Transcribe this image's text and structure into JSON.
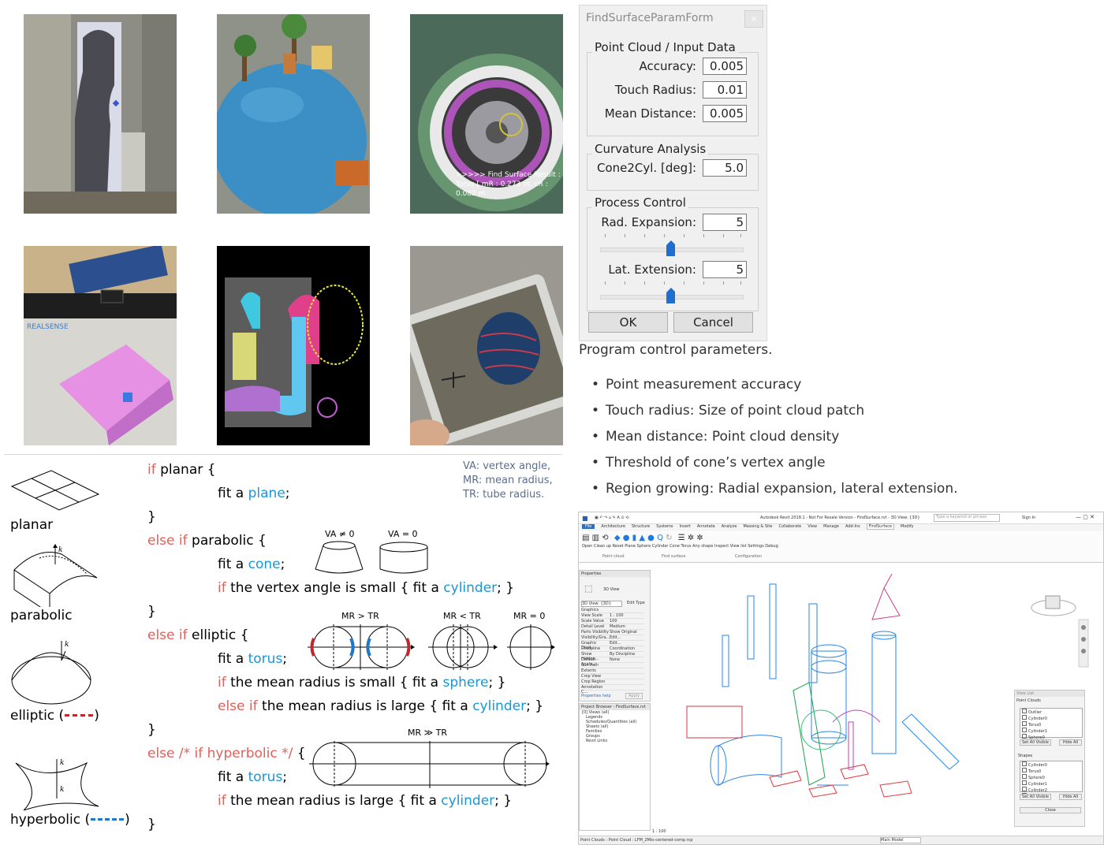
{
  "tiles": [
    {
      "name": "tile-projected-cylinder"
    },
    {
      "name": "tile-balloon-sphere"
    },
    {
      "name": "tile-torus-tire",
      "overlay": [
        ">>>>> Find Surface Result :",
        "Torus [ mR : 0.273 m, cR : 0.082 m"
      ]
    },
    {
      "name": "tile-realsense-box",
      "logo": "REALSENSE"
    },
    {
      "name": "tile-pointcloud-pipes"
    },
    {
      "name": "tile-tablet-sphere"
    }
  ],
  "dialog": {
    "title": "FindSurfaceParamForm",
    "close": "×",
    "group1": "Point Cloud / Input Data",
    "accuracy_label": "Accuracy:",
    "accuracy": "0.005",
    "touch_label": "Touch Radius:",
    "touch": "0.01",
    "mean_label": "Mean Distance:",
    "mean": "0.005",
    "group2": "Curvature Analysis",
    "cone_label": "Cone2Cyl. [deg]:",
    "cone": "5.0",
    "group3": "Process Control",
    "rad_label": "Rad. Expansion:",
    "rad": "5",
    "rad_slider": 0.5,
    "lat_label": "Lat. Extension:",
    "lat": "5",
    "lat_slider": 0.5,
    "ok": "OK",
    "cancel": "Cancel"
  },
  "caption": "Program control parameters.",
  "bullets": [
    "Point measurement accuracy",
    "Touch radius: Size of point cloud patch",
    "Mean distance: Point cloud density",
    "Threshold of cone’s vertex angle",
    "Region growing: Radial expansion, lateral extension."
  ],
  "shapes": {
    "planar": "planar",
    "parabolic": "parabolic",
    "elliptic": "elliptic (",
    "elliptic_end": ")",
    "hyperbolic": "hyperbolic (",
    "hyperbolic_end": ")",
    "k1": "k",
    "k2": "k"
  },
  "legend": [
    "VA: vertex angle,",
    "MR: mean radius,",
    "TR: tube radius."
  ],
  "code": {
    "l1_kw": "if",
    "l1": " planar {",
    "l2_a": "fit a ",
    "l2_fn": "plane",
    "l2_b": ";",
    "l3": "}",
    "l4_kw": "else if",
    "l4": " parabolic {",
    "l5_a": "fit a ",
    "l5_fn": "cone",
    "l5_b": ";",
    "l6_kw": "if",
    "l6_a": " the vertex angle is small { fit a ",
    "l6_fn": "cylinder",
    "l6_b": "; }",
    "l7": "}",
    "l8_kw": "else if",
    "l8": " elliptic {",
    "l9_a": "fit a ",
    "l9_fn": "torus",
    "l9_b": ";",
    "l10_kw": "if",
    "l10_a": " the mean radius is small { fit a ",
    "l10_fn": "sphere",
    "l10_b": "; }",
    "l11_kw": "else if",
    "l11_a": " the mean radius is large { fit a ",
    "l11_fn": "cylinder",
    "l11_b": "; }",
    "l12": "}",
    "l13_kw": "else",
    "l13_cm": " /* if hyperbolic */",
    "l13": " {",
    "l14_a": "fit a ",
    "l14_fn": "torus",
    "l14_b": ";",
    "l15_kw": "if",
    "l15_a": " the mean radius is large { fit a ",
    "l15_fn": "cylinder",
    "l15_b": "; }",
    "l16": "}"
  },
  "diagram_labels": {
    "va_ne": "VA ≠ 0",
    "va_eq": "VA = 0",
    "mr_gt": "MR > TR",
    "mr_lt": "MR < TR",
    "mr_eq": "MR = 0",
    "mr_gg": "MR ≫ TR"
  },
  "colors": {
    "keyword": "#e0605a",
    "function": "#1a96d4",
    "elliptic": "#c0282c",
    "hyperbolic": "#1e78c8"
  },
  "revit": {
    "title": "Autodesk Revit 2018.1 - Not For Resale Version -   FindSurface.rvt - 3D View: {3D}",
    "search": "Type a keyword or phrase",
    "signin": "Sign In",
    "tabs": [
      "File",
      "Architecture",
      "Structure",
      "Systems",
      "Insert",
      "Annotate",
      "Analyze",
      "Massing & Site",
      "Collaborate",
      "View",
      "Manage",
      "Add-Ins",
      "FindSurface",
      "Modify"
    ],
    "tools": [
      "Open",
      "Clean up",
      "Reset",
      "Plane",
      "Sphere",
      "Cylinder",
      "Cone",
      "Torus",
      "Any shape",
      "Inspect",
      "View list",
      "Settings",
      "Debug"
    ],
    "groups": [
      "Point cloud",
      "Find surface",
      "Configuration"
    ],
    "properties_title": "Properties",
    "view_type": "3D View",
    "view_select": "3D View: {3D}",
    "edit_type": "Edit Type",
    "props": [
      [
        "Graphics",
        ""
      ],
      [
        "View Scale",
        "1 : 100"
      ],
      [
        "Scale Value",
        "100"
      ],
      [
        "Detail Level",
        "Medium"
      ],
      [
        "Parts Visibility",
        "Show Original"
      ],
      [
        "Visibility/Gra...",
        "Edit..."
      ],
      [
        "Graphic Displ...",
        "Edit..."
      ],
      [
        "Discipline",
        "Coordination"
      ],
      [
        "Show Hidden...",
        "By Discipline"
      ],
      [
        "Default Analy...",
        "None"
      ],
      [
        "Sun Path",
        ""
      ],
      [
        "Extents",
        ""
      ],
      [
        "Crop View",
        ""
      ],
      [
        "Crop Region ...",
        ""
      ],
      [
        "Annotation C...",
        ""
      ]
    ],
    "help": "Properties help",
    "apply": "Apply",
    "browser_title": "Project Browser - FindSurface.rvt",
    "browser": [
      "[0] Views (all)",
      "Legends",
      "Schedules/Quantities (all)",
      "Sheets (all)",
      "Families",
      "Groups",
      "Revit Links"
    ],
    "viewlist_title": "View List",
    "pc_label": "Point Clouds",
    "pc_items": [
      "Outlier",
      "Cylinder0",
      "Torus0",
      "Cylinder1",
      "Sphere0",
      "Cylinder2"
    ],
    "set_all": "Set All Visible",
    "hide_all": "Hide All",
    "shapes_label": "Shapes",
    "shape_items": [
      "Cylinder0",
      "Torus0",
      "Sphere0",
      "Cylinder1",
      "Cylinder2",
      "Cylinder3"
    ],
    "close": "Close",
    "scale": "1 : 100",
    "status": "Point Clouds : Point Cloud : LFM_2Mio-centered-comp.rcp",
    "main_model": "Main Model"
  }
}
